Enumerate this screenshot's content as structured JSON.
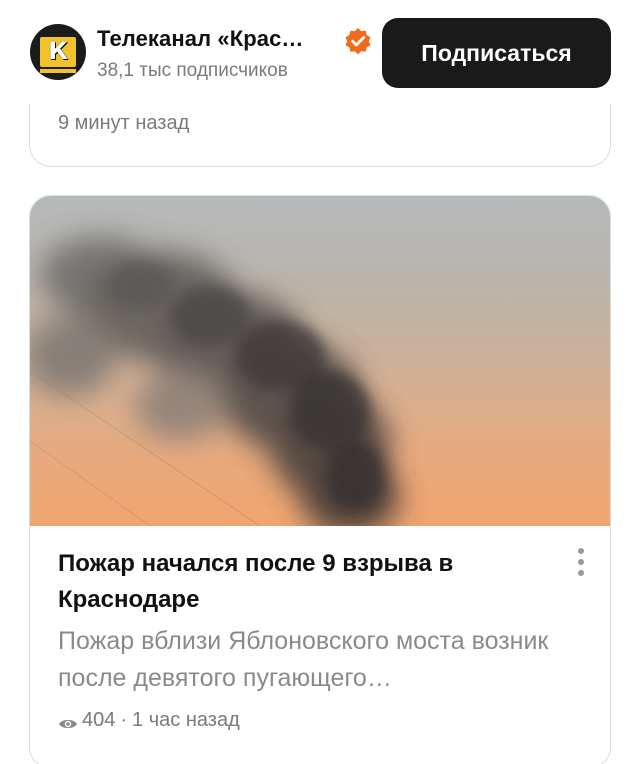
{
  "channel": {
    "name": "Телеканал «Крас…",
    "subscribers": "38,1 тыс подписчиков",
    "avatar_letter": "К",
    "subscribe_label": "Подписаться",
    "verified_icon": "verified-check-icon",
    "verified_color": "#f26a1b"
  },
  "previous_card": {
    "time": "9 минут назад"
  },
  "article": {
    "title": "Пожар начался после 9 взрыва в Краснодаре",
    "snippet": "Пожар вблизи Яблоновского моста возник после девятого пугающего…",
    "views": "404",
    "separator": "·",
    "time": "1 час назад",
    "image_icon": "smoke-photo",
    "menu_icon": "more-vertical-icon"
  }
}
